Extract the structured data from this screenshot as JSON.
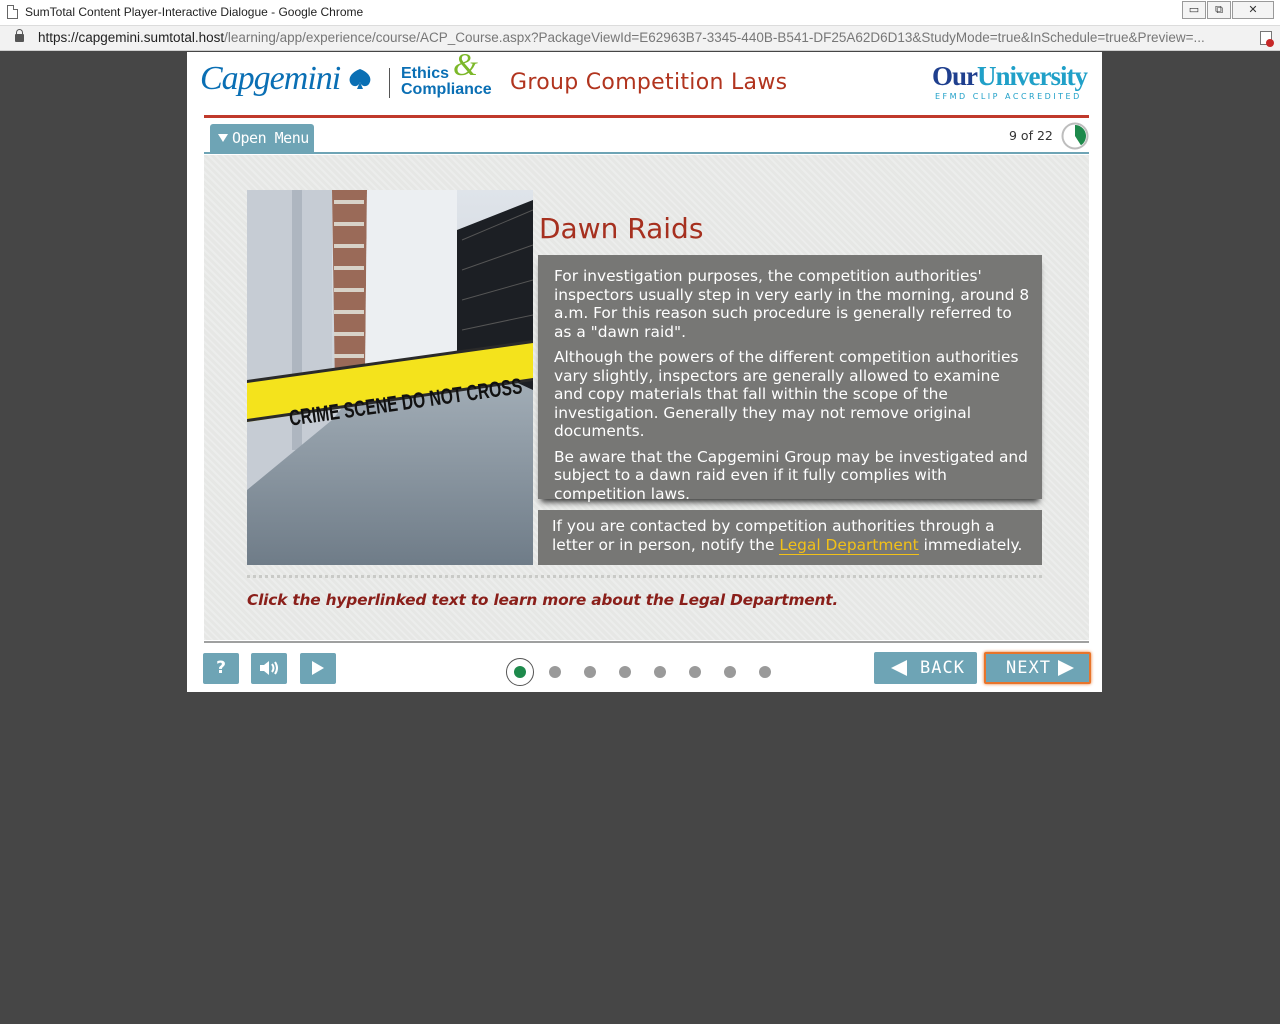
{
  "window": {
    "title": "SumTotal Content Player-Interactive Dialogue - Google Chrome",
    "controls": {
      "minimize": "▭",
      "restore": "⧉",
      "close": "✕"
    }
  },
  "address": {
    "host": "https://capgemini.sumtotal.host",
    "path": "/learning/app/experience/course/ACP_Course.aspx?PackageViewId=E62963B7-3345-440B-B541-DF25A62D6D13&StudyMode=true&InSchedule=true&Preview=..."
  },
  "header": {
    "brand": "Capgemini",
    "ethics_line1": "Ethics",
    "ethics_amp": "&",
    "ethics_line2": "Compliance",
    "course_title": "Group Competition Laws",
    "university_our": "Our",
    "university_uni": "University",
    "accreditation": "EFMD CLIP ACCREDITED"
  },
  "menu": {
    "label": "Open Menu"
  },
  "progress": {
    "current": 9,
    "total": 22,
    "label": "9 of 22"
  },
  "slide": {
    "image_caption": "CRIME SCENE DO NOT CROSS",
    "title": "Dawn Raids",
    "paragraphs": [
      "For investigation purposes, the competition authorities' inspectors usually step in very early in the morning, around 8 a.m. For this reason such procedure is generally referred to as a \"dawn raid\".",
      "Although the powers of the different competition authorities vary slightly, inspectors are generally allowed to examine and copy materials that fall within the scope of the investigation. Generally they may not remove original documents.",
      "Be aware that the Capgemini Group may be investigated and subject to a dawn raid even if it fully complies with competition laws."
    ],
    "note_before": "If you are contacted by competition authorities through a letter or in person, notify the ",
    "note_link": "Legal Department",
    "note_after": " immediately.",
    "instruction": "Click the hyperlinked text to learn more about the Legal Department."
  },
  "controls": {
    "help_label": "?",
    "dots_count": 8,
    "active_dot": 0,
    "back_label": "BACK",
    "next_label": "NEXT"
  },
  "colors": {
    "brand_blue": "#0a6fb4",
    "accent_red": "#c0392b",
    "teal": "#6ea4b5",
    "text_box": "#777775",
    "link_yellow": "#f2c117",
    "progress_green": "#1e8a4c"
  }
}
